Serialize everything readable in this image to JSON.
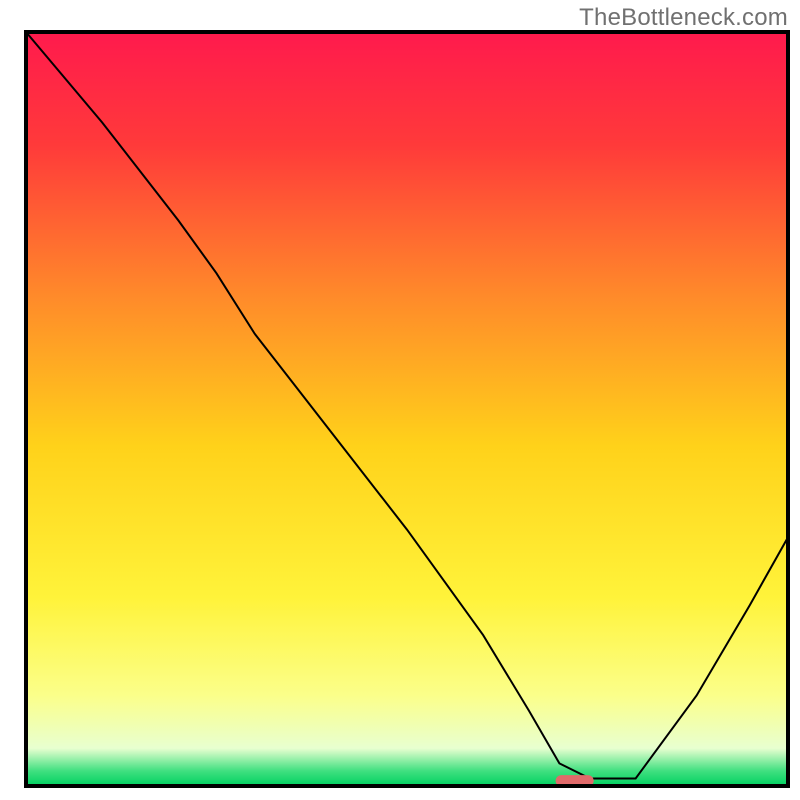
{
  "watermark": "TheBottleneck.com",
  "chart_data": {
    "type": "line",
    "title": "",
    "xlabel": "",
    "ylabel": "",
    "xlim": [
      0,
      100
    ],
    "ylim": [
      0,
      100
    ],
    "axes_visible": false,
    "grid": false,
    "legend": false,
    "background": {
      "type": "vertical-gradient",
      "stops": [
        {
          "offset": 0.0,
          "color": "#ff1a4d"
        },
        {
          "offset": 0.15,
          "color": "#ff3a3a"
        },
        {
          "offset": 0.35,
          "color": "#ff8a2a"
        },
        {
          "offset": 0.55,
          "color": "#ffd21a"
        },
        {
          "offset": 0.75,
          "color": "#fff33a"
        },
        {
          "offset": 0.88,
          "color": "#fbff8a"
        },
        {
          "offset": 0.95,
          "color": "#e8ffd0"
        },
        {
          "offset": 0.98,
          "color": "#40e080"
        },
        {
          "offset": 1.0,
          "color": "#00d060"
        }
      ]
    },
    "series": [
      {
        "name": "curve",
        "color": "#000000",
        "stroke_width": 2,
        "x": [
          0,
          10,
          20,
          25,
          30,
          40,
          50,
          60,
          66,
          70,
          74,
          80,
          88,
          95,
          100
        ],
        "y": [
          100,
          88,
          75,
          68,
          60,
          47,
          34,
          20,
          10,
          3,
          1,
          1,
          12,
          24,
          33
        ]
      }
    ],
    "marker": {
      "name": "highlight",
      "shape": "rounded-rect",
      "color": "#e06a6a",
      "x": 72,
      "y": 0.7,
      "width": 5,
      "height": 1.5
    },
    "frame": {
      "color": "#000000",
      "width": 4
    }
  }
}
